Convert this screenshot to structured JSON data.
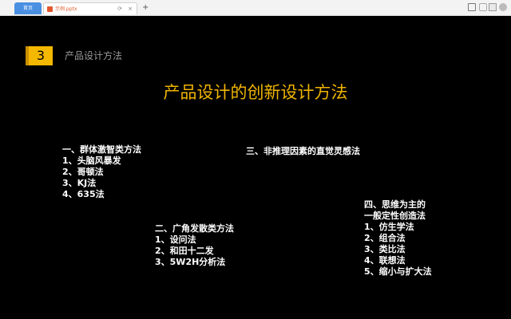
{
  "browser": {
    "tabs": [
      {
        "label": "首页"
      },
      {
        "label": "示例.pptx"
      }
    ],
    "new_tab": "+",
    "close": "×"
  },
  "slide": {
    "section_number": "3",
    "section_title": "产品设计方法",
    "title": "产品设计的创新设计方法",
    "blocks": [
      {
        "heading": "一、群体激智类方法",
        "items": [
          "1、头脑风暴发",
          "2、哥顿法",
          "3、KJ法",
          "4、635法"
        ]
      },
      {
        "heading": "二、广角发散类方法",
        "items": [
          "1、设问法",
          "2、和田十二发",
          "3、5W2H分析法"
        ]
      },
      {
        "heading": "三、非推理因素的直觉灵感法",
        "items": []
      },
      {
        "heading_lines": [
          "四、思维为主的",
          "一般定性创造法"
        ],
        "items": [
          "1、仿生学法",
          "2、组合法",
          "3、类比法",
          "4、联想法",
          "5、缩小与扩大法"
        ]
      }
    ]
  },
  "colors": {
    "background": "#000000",
    "accent": "#f5b800",
    "title": "#f0b400",
    "muted_text": "#9a9a9a"
  }
}
